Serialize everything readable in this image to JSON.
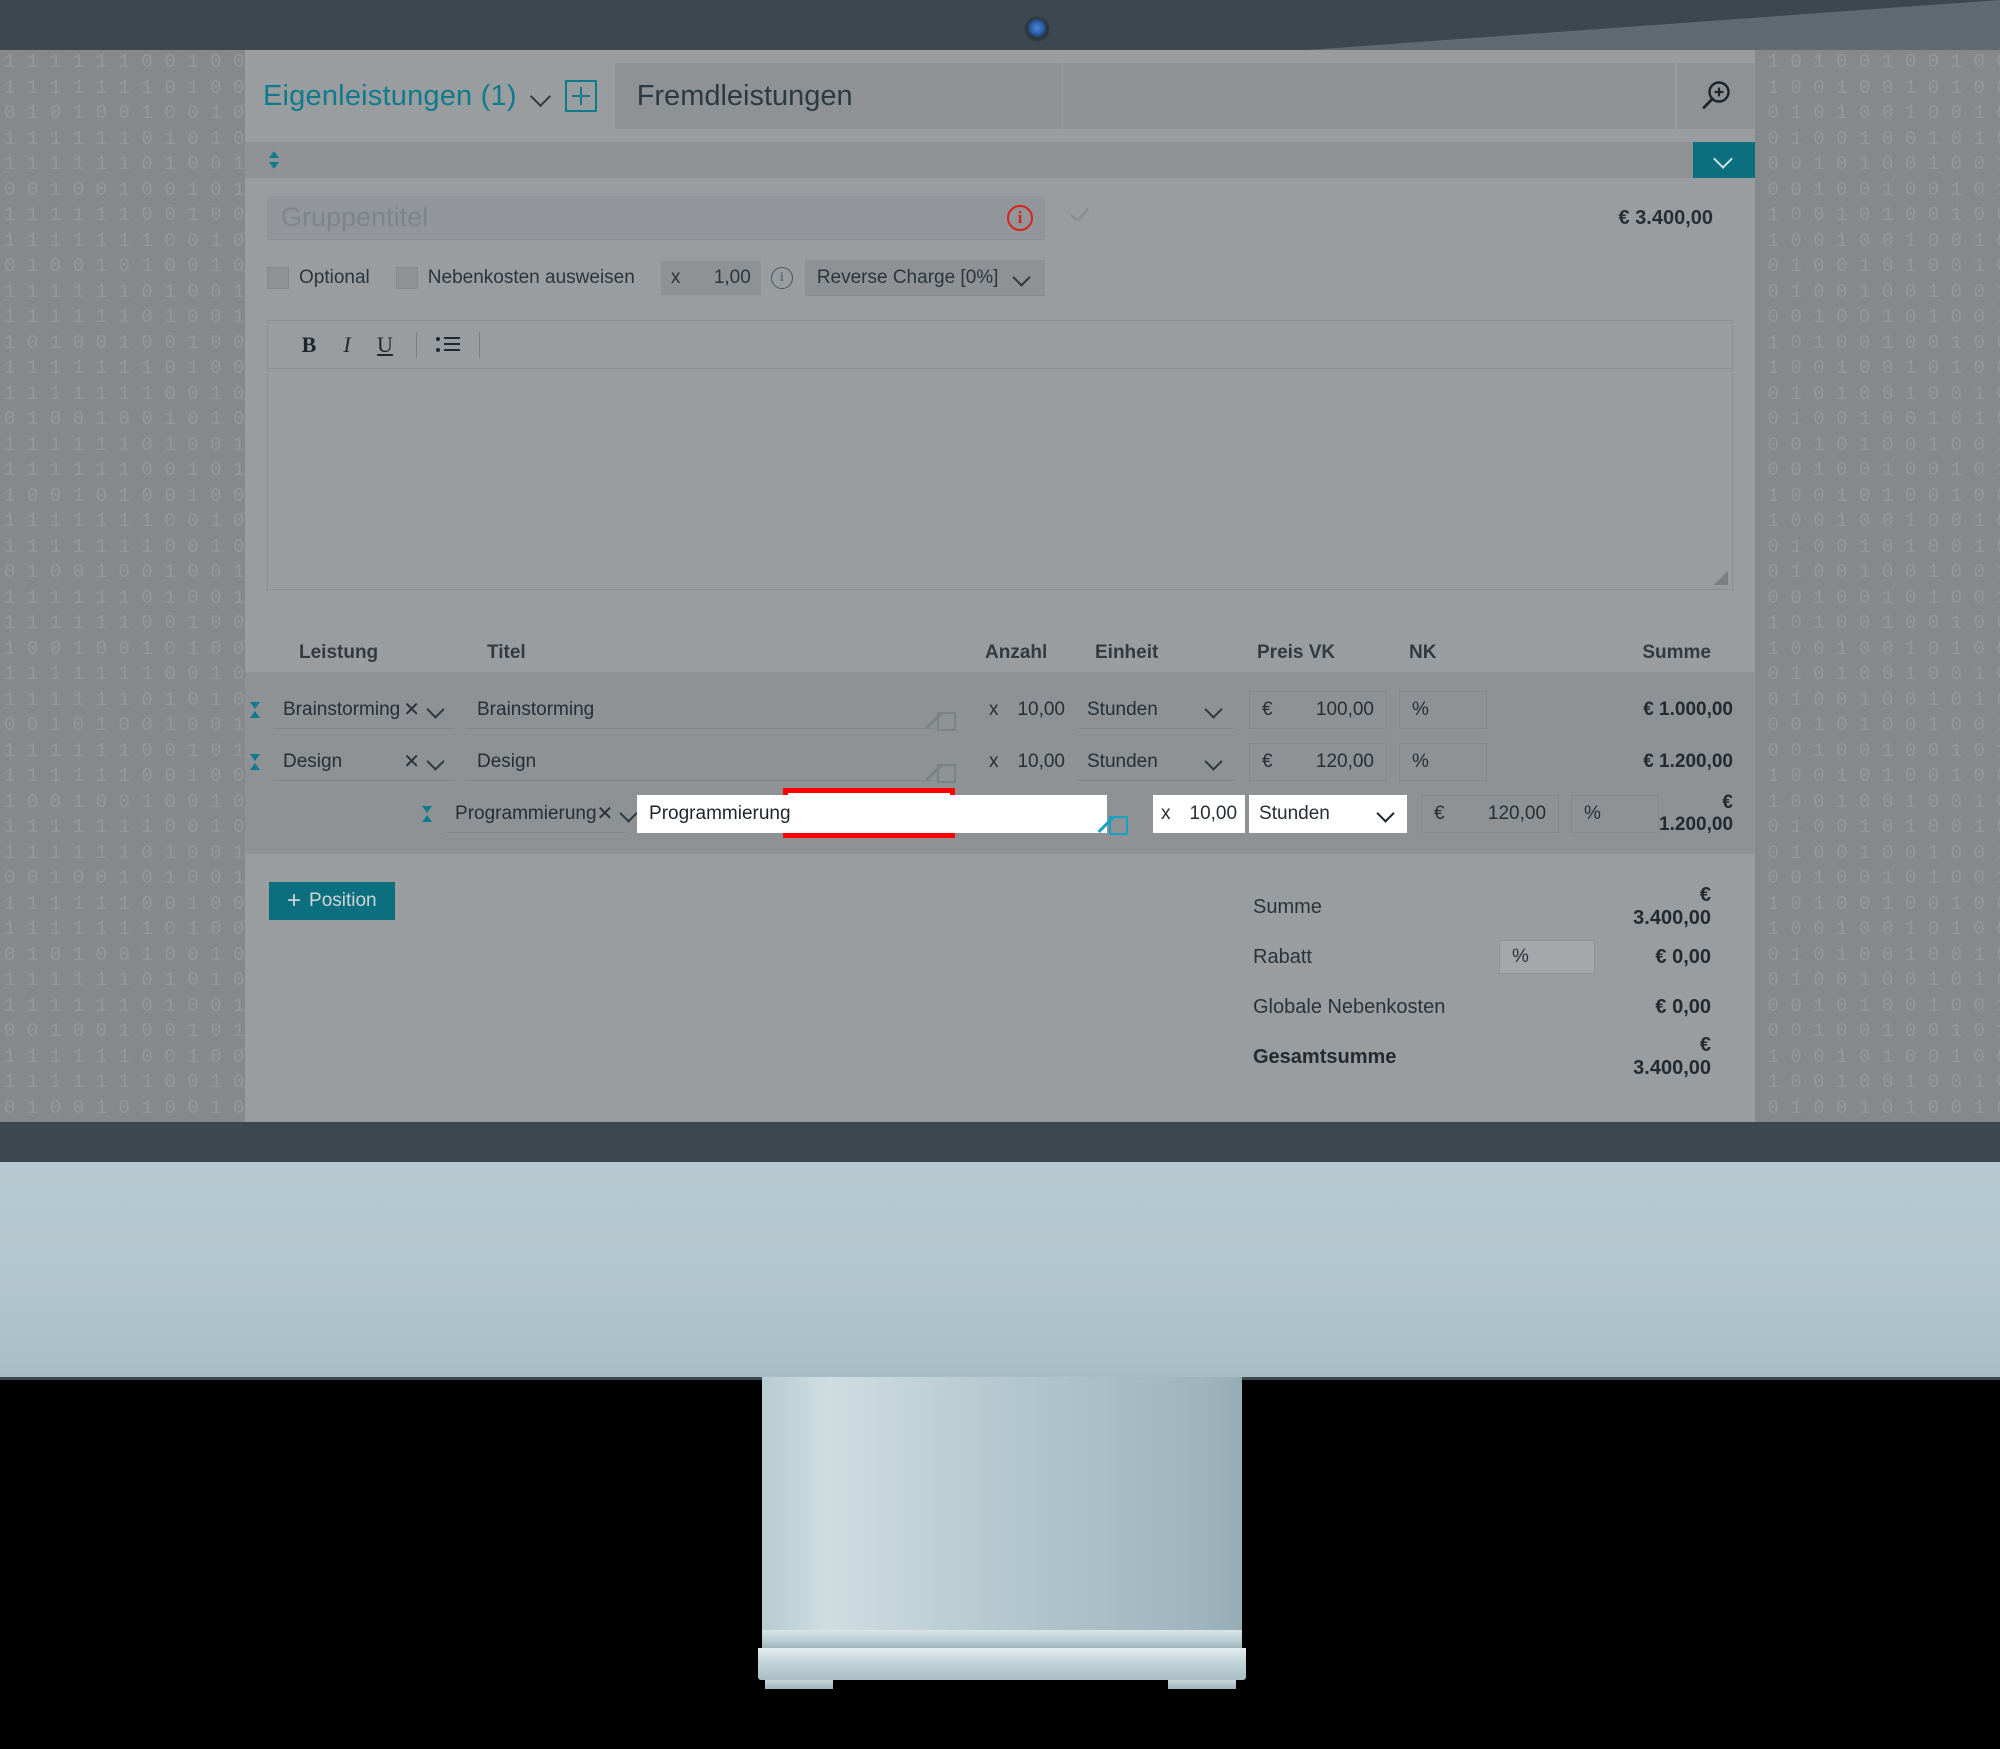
{
  "header": {
    "tab_active_label": "Eigenleistungen (1)",
    "tab_inactive_label": "Fremdleistungen",
    "add_icon": "plus-box-icon",
    "dropdown_icon": "chevron-down-icon",
    "search_icon": "magnifier-plus-icon"
  },
  "group": {
    "title_placeholder": "Gruppentitel",
    "title_value": "",
    "info_icon": "info-error-icon",
    "confirm_icon": "check-icon",
    "total": "€ 3.400,00",
    "collapse_icon": "chevron-down-icon",
    "sort_icon": "sort-handle-icon",
    "options": {
      "optional_label": "Optional",
      "nebenkosten_label": "Nebenkosten ausweisen",
      "multiplier_prefix": "x",
      "multiplier_value": "1,00",
      "multiplier_info_icon": "info-icon",
      "tax_select_value": "Reverse Charge [0%]"
    }
  },
  "editor": {
    "bold_label": "B",
    "italic_label": "I",
    "underline_label": "U",
    "list_icon": "bullet-list-icon",
    "content": ""
  },
  "table": {
    "columns": [
      "Leistung",
      "Titel",
      "Anzahl",
      "Einheit",
      "Preis VK",
      "NK",
      "Summe"
    ],
    "rows": [
      {
        "leistung": "Brainstorming",
        "titel": "Brainstorming",
        "anzahl_prefix": "x",
        "anzahl": "10,00",
        "einheit": "Stunden",
        "currency": "€",
        "preis": "100,00",
        "nk": "%",
        "summe": "€ 1.000,00",
        "focused": false
      },
      {
        "leistung": "Design",
        "titel": "Design",
        "anzahl_prefix": "x",
        "anzahl": "10,00",
        "einheit": "Stunden",
        "currency": "€",
        "preis": "120,00",
        "nk": "%",
        "summe": "€ 1.200,00",
        "focused": false
      },
      {
        "leistung": "Programmierung",
        "titel": "Programmierung",
        "anzahl_prefix": "x",
        "anzahl": "10,00",
        "einheit": "Stunden",
        "currency": "€",
        "preis": "120,00",
        "nk": "%",
        "summe": "€ 1.200,00",
        "focused": true
      }
    ],
    "clear_icon": "clear-x-icon",
    "dropdown_icon": "chevron-down-icon",
    "edit_icon": "edit-pencil-icon"
  },
  "footer": {
    "add_position_label": "Position",
    "add_position_plus": "+",
    "totals": [
      {
        "label": "Summe",
        "mid": "",
        "value": "€ 3.400,00"
      },
      {
        "label": "Rabatt",
        "mid": "%",
        "value": "€ 0,00"
      },
      {
        "label": "Globale Nebenkosten",
        "mid": "",
        "value": "€ 0,00"
      },
      {
        "label": "Gesamtsumme",
        "mid": "",
        "value": "€ 3.400,00"
      }
    ]
  },
  "colors": {
    "accent_teal": "#0b6f80",
    "link_teal": "#0d7b8c",
    "highlight_red": "#ff0000",
    "error_red": "#d8221e",
    "edit_active": "#15a3c4"
  }
}
